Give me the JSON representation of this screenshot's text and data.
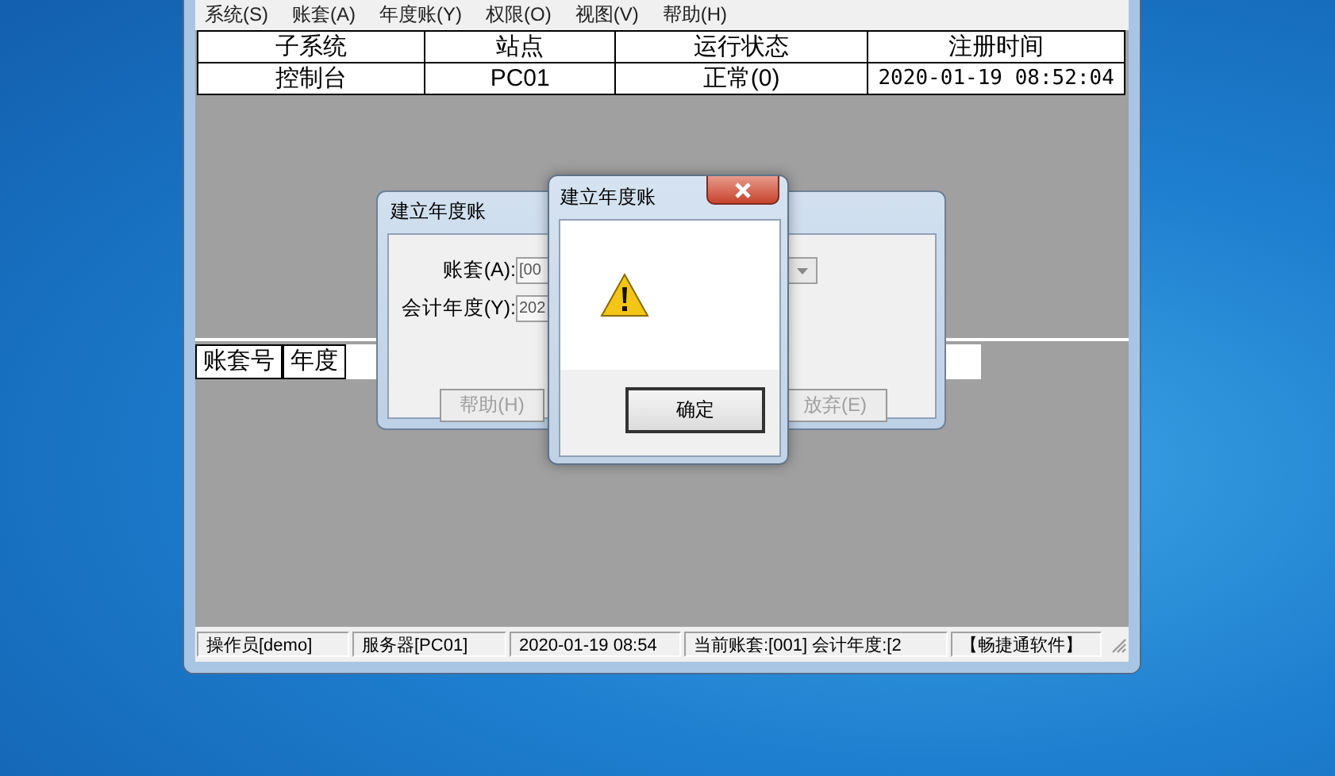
{
  "menu": [
    "系统(S)",
    "账套(A)",
    "年度账(Y)",
    "权限(O)",
    "视图(V)",
    "帮助(H)"
  ],
  "process_table": {
    "columns": [
      "子系统",
      "站点",
      "运行状态",
      "注册时间"
    ],
    "rows": [
      [
        "控制台",
        "PC01",
        "正常(0)",
        "2020-01-19 08:52:04"
      ]
    ]
  },
  "account_table": {
    "columns": [
      "账套号",
      "年度"
    ]
  },
  "status_bar": [
    "操作员[demo]",
    "服务器[PC01]",
    "2020-01-19 08:54",
    "当前账套:[001] 会计年度:[2",
    "【畅捷通软件】"
  ],
  "dialog": {
    "title": "建立年度账",
    "fields": [
      {
        "kind": "combo",
        "label": "账套(A):",
        "value": "[00"
      },
      {
        "kind": "text",
        "label": "会计年度(Y):",
        "value": "202"
      }
    ],
    "buttons": [
      {
        "label": "帮助(H)",
        "disabled": true
      },
      {
        "label": "放弃(E)",
        "disabled": true
      }
    ]
  },
  "message_box": {
    "title": "建立年度账",
    "buttons": [
      "确定"
    ]
  }
}
